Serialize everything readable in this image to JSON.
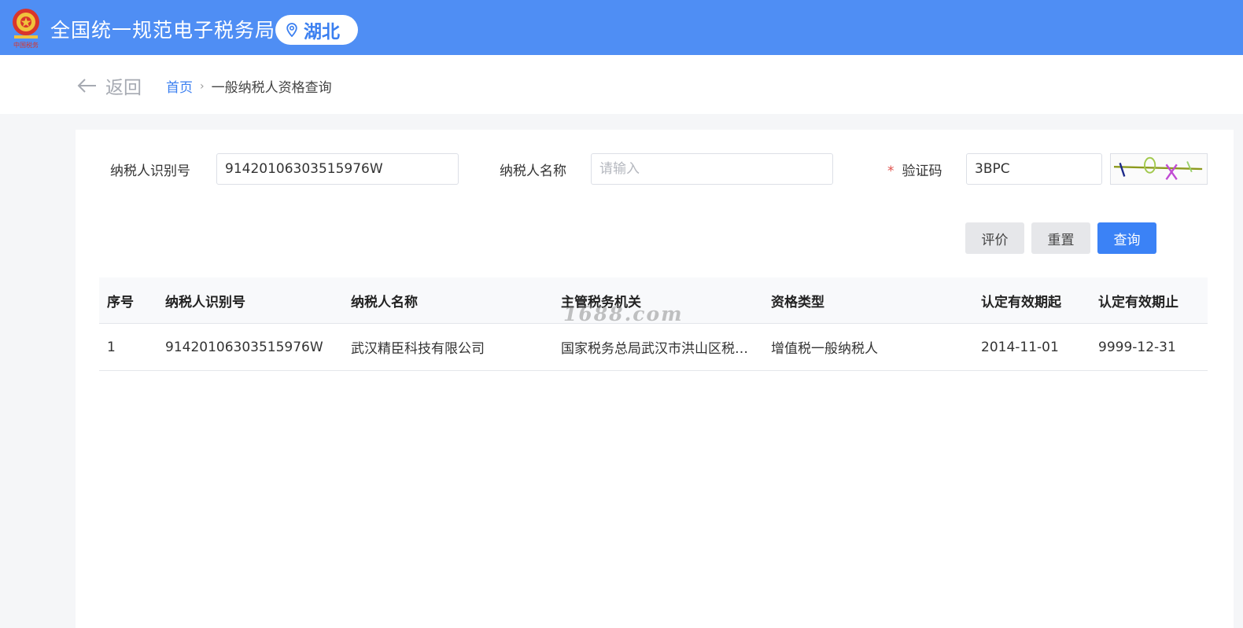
{
  "header": {
    "site_title": "全国统一规范电子税务局",
    "region": "湖北",
    "emblem_text": "中国税务"
  },
  "nav": {
    "back_label": "返回",
    "breadcrumb_home": "首页",
    "breadcrumb_separator": "›",
    "breadcrumb_current": "一般纳税人资格查询"
  },
  "form": {
    "taxpayer_id_label": "纳税人识别号",
    "taxpayer_id_value": "91420106303515976W",
    "taxpayer_name_label": "纳税人名称",
    "taxpayer_name_placeholder": "请输入",
    "taxpayer_name_value": "",
    "captcha_required_mark": "*",
    "captcha_label": "验证码",
    "captcha_value": "3BPC"
  },
  "buttons": {
    "evaluate": "评价",
    "reset": "重置",
    "query": "查询"
  },
  "table": {
    "columns": [
      "序号",
      "纳税人识别号",
      "纳税人名称",
      "主管税务机关",
      "资格类型",
      "认定有效期起",
      "认定有效期止"
    ],
    "rows": [
      [
        "1",
        "91420106303515976W",
        "武汉精臣科技有限公司",
        "国家税务总局武汉市洪山区税务局",
        "增值税一般纳税人",
        "2014-11-01",
        "9999-12-31"
      ]
    ]
  },
  "watermark": "1688.com",
  "colors": {
    "header_bg": "#4f8ef4",
    "primary_button": "#3b82f6",
    "link": "#3b7ff0",
    "required": "#e0504b"
  },
  "icons": {
    "emblem": "tax-emblem-icon",
    "region": "location-pin-icon",
    "back": "arrow-left-icon",
    "captcha": "captcha-image"
  }
}
